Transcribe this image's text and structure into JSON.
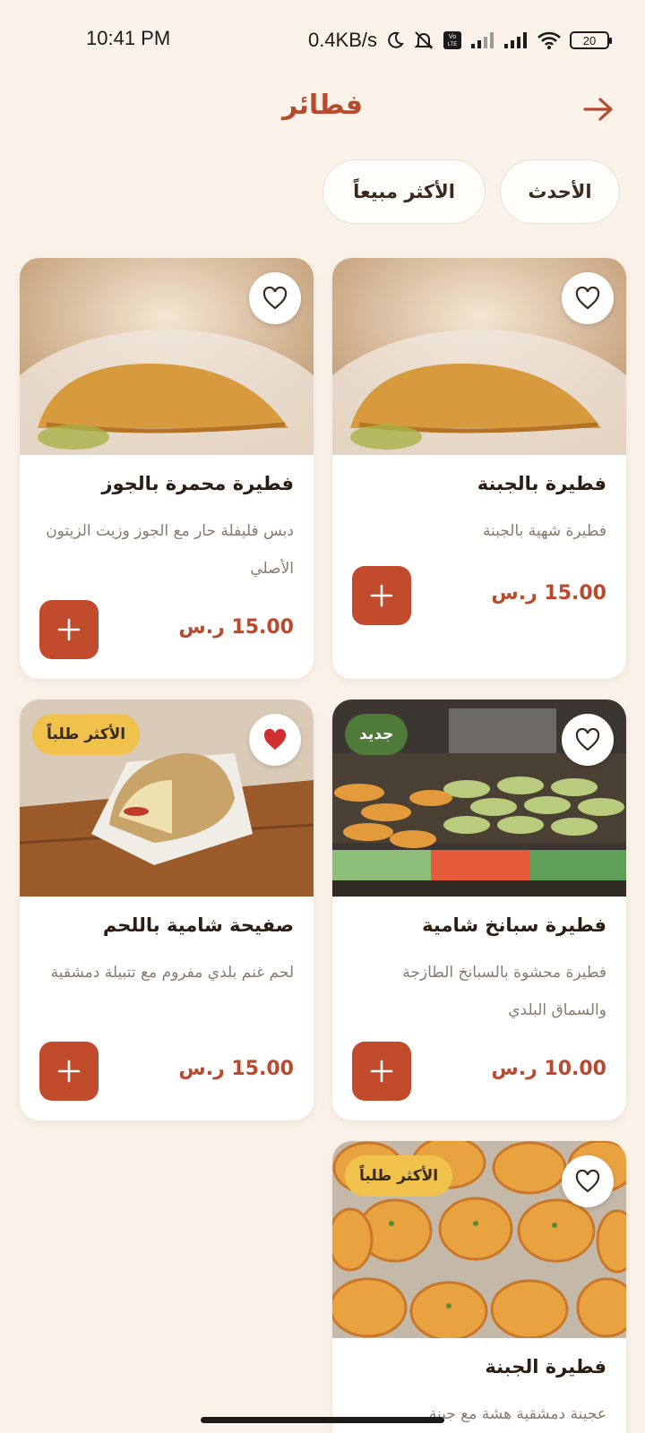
{
  "status_bar": {
    "time": "10:41 PM",
    "net_speed": "0.4KB/s",
    "battery": "20",
    "icons": [
      "moon-icon",
      "mute-icon",
      "volte-icon",
      "signal-icon",
      "signal-icon",
      "wifi-icon",
      "battery-icon"
    ]
  },
  "header": {
    "title": "فطائر",
    "back_icon": "arrow-right-icon"
  },
  "filters": [
    {
      "label": "الأحدث"
    },
    {
      "label": "الأكثر مبيعاً"
    }
  ],
  "colors": {
    "accent": "#c24b2d",
    "price": "#b94a2e",
    "background": "#fbf3ea",
    "badge_popular": "#f0c24b",
    "badge_new": "#4e7a3a",
    "fav_active": "#d12f2f"
  },
  "products": [
    {
      "name": "فطيرة بالجبنة",
      "description": "فطيرة شهية بالجبنة",
      "price": "15.00 ر.س",
      "favorite": false,
      "badge": ""
    },
    {
      "name": "فطيرة محمرة بالجوز",
      "description": "دبس فليفلة حار مع الجوز وزيت الزيتون الأصلي",
      "price": "15.00 ر.س",
      "favorite": false,
      "badge": ""
    },
    {
      "name": "فطيرة سبانخ شامية",
      "description": "فطيرة محشوة بالسبانخ الطازجة والسماق البلدي",
      "price": "10.00 ر.س",
      "favorite": false,
      "badge": "جديد"
    },
    {
      "name": "صفيحة شامية باللحم",
      "description": "لحم غنم بلدي مفروم مع تتبيلة دمشقية",
      "price": "15.00 ر.س",
      "favorite": true,
      "badge": "الأكثر طلباً"
    },
    {
      "name": "فطيرة الجبنة",
      "description": "عجينة دمشقية هشة مع جبنة",
      "price": "",
      "favorite": false,
      "badge": "الأكثر طلباً"
    }
  ]
}
